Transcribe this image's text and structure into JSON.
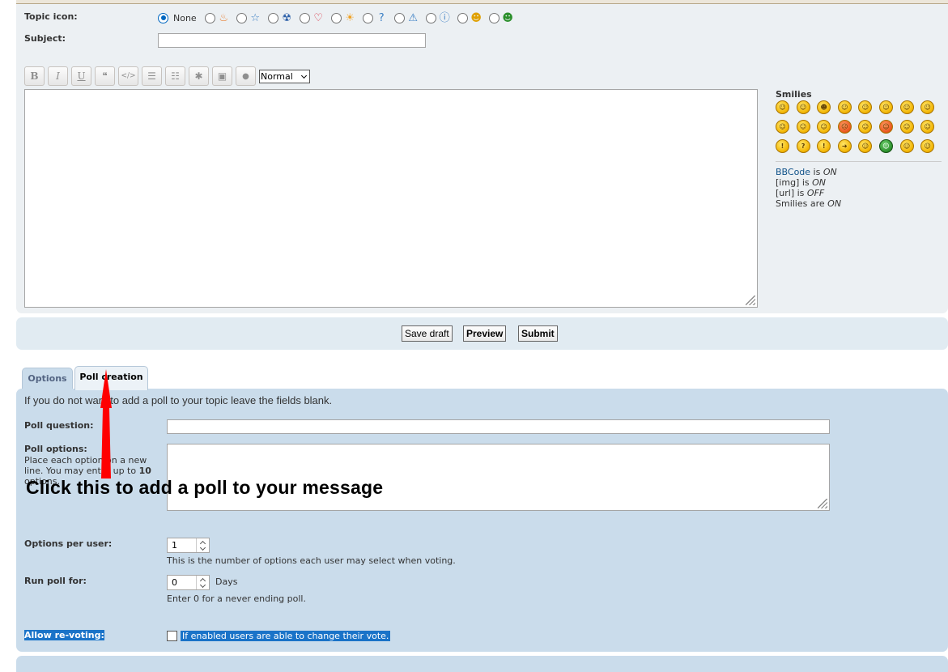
{
  "topic_icon": {
    "label": "Topic icon:",
    "none_label": "None",
    "icons": [
      "fire-icon",
      "star-icon",
      "radioactive-icon",
      "heart-icon",
      "star-glow-icon",
      "question-icon",
      "warning-icon",
      "info-icon",
      "surprised-face-icon",
      "grin-face-icon"
    ]
  },
  "subject": {
    "label": "Subject:",
    "value": ""
  },
  "toolbar": {
    "bold": "B",
    "italic": "I",
    "underline": "U",
    "quote": "❝",
    "code": "</>",
    "list": "☰",
    "list_numbered": "☷",
    "list_item": "✱",
    "image": "▣",
    "color": "●",
    "font_size": "Normal"
  },
  "message": {
    "value": ""
  },
  "smilies": {
    "title": "Smilies",
    "faces": [
      "☺",
      "☺",
      "☻",
      "☺",
      "☺",
      "☺",
      "☺",
      "☺",
      "☺",
      "☺",
      "☺",
      "☹",
      "☺",
      "☺",
      "☺",
      "☺",
      "!",
      "?",
      "!",
      "➜",
      "☺",
      "☺",
      "☺",
      "☺"
    ]
  },
  "status": {
    "bbcode_link": "BBCode",
    "bbcode_rest": " is ",
    "bbcode_state": "ON",
    "img_label": "[img] is ",
    "img_state": "ON",
    "url_label": "[url] is ",
    "url_state": "OFF",
    "smilies_label": "Smilies are ",
    "smilies_state": "ON"
  },
  "buttons": {
    "save_draft": "Save draft",
    "preview": "Preview",
    "submit": "Submit"
  },
  "tabs": {
    "options": "Options",
    "poll_creation": "Poll creation"
  },
  "poll": {
    "intro": "If you do not want to add a poll to your topic leave the fields blank.",
    "question_label": "Poll question:",
    "question_value": "",
    "options_label": "Poll options:",
    "options_help_1": "Place each option on a new line. You may enter up to ",
    "options_max": "10",
    "options_help_2": " options.",
    "options_value": "",
    "per_user_label": "Options per user:",
    "per_user_value": "1",
    "per_user_explain": "This is the number of options each user may select when voting.",
    "run_for_label": "Run poll for:",
    "run_for_value": "0",
    "run_for_unit": "Days",
    "run_for_explain": "Enter 0 for a never ending poll.",
    "revote_label": "Allow re-voting:",
    "revote_explain": "If enabled users are able to change their vote."
  },
  "annotation": {
    "text": "Click this to add a poll to your message",
    "arrow_color": "#ff0000"
  },
  "colors": {
    "panel_light": "#ecf0f3",
    "panel_blue": "#cadceb",
    "link": "#105289",
    "selection": "#1a73c8"
  }
}
